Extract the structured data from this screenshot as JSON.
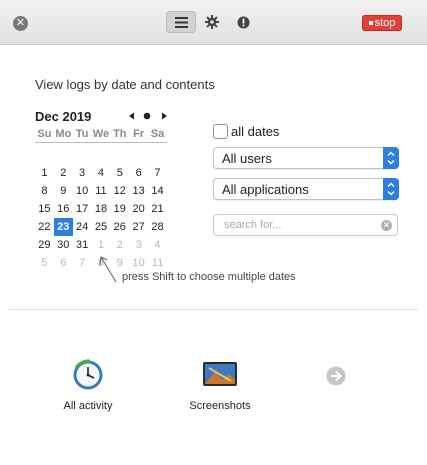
{
  "toolbar": {
    "close_icon": "close-icon",
    "icons": [
      "list-icon",
      "gear-icon",
      "alert-icon"
    ],
    "stop_label": "stop",
    "stop_color": "#e0403a"
  },
  "heading": "View logs by date and contents",
  "calendar": {
    "month_label": "Dec 2019",
    "weekdays": [
      "Su",
      "Mo",
      "Tu",
      "We",
      "Th",
      "Fr",
      "Sa"
    ],
    "weeks": [
      [
        "",
        "",
        "",
        "",
        "",
        "",
        ""
      ],
      [
        "1",
        "2",
        "3",
        "4",
        "5",
        "6",
        "7"
      ],
      [
        "8",
        "9",
        "10",
        "11",
        "12",
        "13",
        "14"
      ],
      [
        "15",
        "16",
        "17",
        "18",
        "19",
        "20",
        "21"
      ],
      [
        "22",
        "23",
        "24",
        "25",
        "26",
        "27",
        "28"
      ],
      [
        "29",
        "30",
        "31",
        "1",
        "2",
        "3",
        "4"
      ],
      [
        "5",
        "6",
        "7",
        "8",
        "9",
        "10",
        "11"
      ]
    ],
    "selected_day": "23",
    "accent": "#2a7fe0"
  },
  "filters": {
    "all_dates_label": "all dates",
    "all_dates_checked": false,
    "users_value": "All users",
    "apps_value": "All applications",
    "search_placeholder": "search for..."
  },
  "hint": "press Shift to choose multiple dates",
  "bottom": {
    "all_activity_label": "All activity",
    "screenshots_label": "Screenshots"
  }
}
